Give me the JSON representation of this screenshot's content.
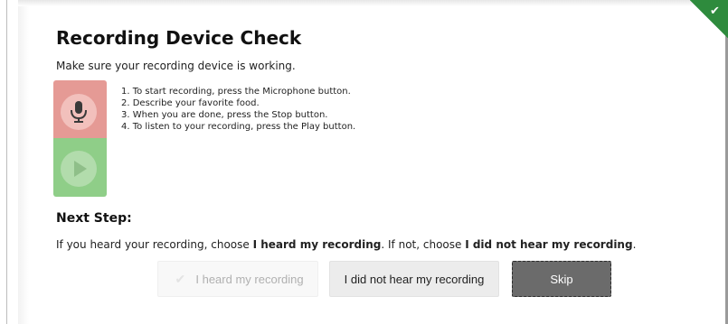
{
  "title": "Recording Device Check",
  "subtitle": "Make sure your recording device is working.",
  "instructions": [
    "1. To start recording, press the Microphone button.",
    "2. Describe your favorite food.",
    "3. When you are done, press the Stop button.",
    "4. To listen to your recording, press the Play button."
  ],
  "next_step": {
    "heading": "Next Step:",
    "text_1": "If you heard your recording, choose ",
    "bold_1": "I heard my recording",
    "text_2": ". If not, choose ",
    "bold_2": "I did not hear my recording",
    "text_3": "."
  },
  "buttons": {
    "heard": "I heard my recording",
    "not_heard": "I did not hear my recording",
    "skip": "Skip"
  },
  "icons": {
    "corner": "check-icon",
    "record": "microphone-icon",
    "play": "play-icon"
  },
  "colors": {
    "record_bg": "#e59a95",
    "play_bg": "#8fce88",
    "corner_badge": "#2e8b3d",
    "skip_bg": "#6b6b6b"
  }
}
